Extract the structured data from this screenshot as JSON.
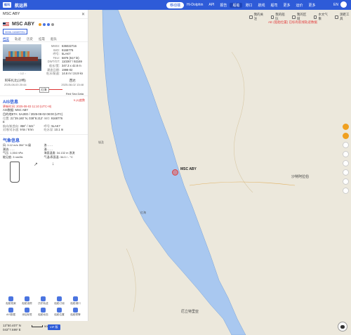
{
  "topbar": {
    "logo": "船讯",
    "app_name": "航运界",
    "nav": [
      {
        "label": "移动端",
        "active": true
      },
      {
        "label": "Hi-Dolphin",
        "active": false
      },
      {
        "label": "API",
        "active": false
      },
      {
        "label": "报告",
        "active": false
      },
      {
        "label": "船舶",
        "active": false,
        "pill": true
      },
      {
        "label": "港口",
        "active": false
      },
      {
        "label": "航线",
        "active": false
      },
      {
        "label": "船司",
        "active": false
      },
      {
        "label": "更多",
        "active": false
      },
      {
        "label": "运价",
        "active": false
      },
      {
        "label": "更多",
        "active": false
      }
    ],
    "lang": "EN"
  },
  "map_toolbar": [
    "我的关注",
    "我的船队",
    "我的区域",
    "水文气象",
    "测距工具"
  ],
  "map_alert": "AE (船舶位置) 已标有航线轨迹数据",
  "panel": {
    "header_title": "MSC ABY",
    "ship_name": "MSC ABY",
    "chips": [
      "3006-11669TEU"
    ],
    "tabs": [
      "档案",
      "轨迹",
      "历史",
      "挂靠",
      "船队"
    ],
    "photo_nav": "‹ 1/2 ›",
    "kv": [
      {
        "k": "MMSI:",
        "v": "636022716"
      },
      {
        "k": "IMO:",
        "v": "9168776"
      },
      {
        "k": "呼号:",
        "v": "5LAK7"
      },
      {
        "k": "TEU:",
        "v": "5878 (617 kt)"
      },
      {
        "k": "DWT/GT:",
        "v": "110267 / 92169"
      },
      {
        "k": "船长/宽:",
        "v": "347.3 x 42.8 m"
      },
      {
        "k": "建造日期:",
        "v": "1998-02"
      },
      {
        "k": "吃水/航速:",
        "v": "14.6 m / 24.9 kn"
      }
    ],
    "from_port": "阿布扎比(沙特)",
    "from_time": "2025-08-03 20:44",
    "to_port": "西达",
    "to_time": "2025-08-02 13:48",
    "route_mid": "红海",
    "route_note": "Red Sea Data",
    "ais_title": "AIS信息",
    "ais_sub": "5 (4)度数",
    "ais_update_label": "更新时间:",
    "ais_update_value": "2025-08-03 11:10 (UTC+8)",
    "ais_source_label": "AIS数据:",
    "ais_source_value": "MSC ABY",
    "ais_eta_label": "目的地ETA:",
    "ais_eta_value": "SAJED / 2025-08-02 08:00 (UTC)",
    "ais_grid": [
      {
        "k": "位置:",
        "v": "21°39.160' N, 038°8.212' E"
      },
      {
        "k": "IMO:",
        "v": "9168776"
      },
      {
        "k": "航向/航首向:",
        "v": "356° / 341°"
      },
      {
        "k": "呼号:",
        "v": "5LAK7"
      },
      {
        "k": "对地/对水速:",
        "v": "9 kn / 8 kn"
      },
      {
        "k": "吃水深:",
        "v": "10.1 m"
      }
    ],
    "wx_title": "气象信息",
    "wx": [
      {
        "k": "风:",
        "v": "3.12 m/s 354° N 级"
      },
      {
        "k": "浪:",
        "v": "- - -"
      },
      {
        "k": "潮流:",
        "v": "- - -"
      },
      {
        "k": "涌:",
        "v": "- - -"
      },
      {
        "k": "气压:",
        "v": "1,004 hPa"
      },
      {
        "k": "海面温度:",
        "v": "34.132 m 浪流"
      },
      {
        "k": "能见度:",
        "v": "3 nm/5k"
      },
      {
        "k": "气温/表面温:",
        "v": "34.0 / -  °C"
      }
    ],
    "bottom_tools": [
      "船舶档案",
      "船舶追踪",
      "历史轨迹",
      "船舶订阅",
      "船舶港口",
      "AIS数据",
      "添加标签",
      "船舶动态",
      "船舶位置",
      "船舶预警"
    ]
  },
  "map_labels": [
    {
      "text": "沙特阿拉伯",
      "big": true
    },
    {
      "text": "厄立特里亚",
      "big": true
    },
    {
      "text": "红海",
      "big": false
    },
    {
      "text": "埃及",
      "big": false
    }
  ],
  "coords": {
    "lat": "13°50.407' N",
    "lon": "043°7.699' E"
  },
  "scale_label": "50km",
  "vip": "VIP 版"
}
